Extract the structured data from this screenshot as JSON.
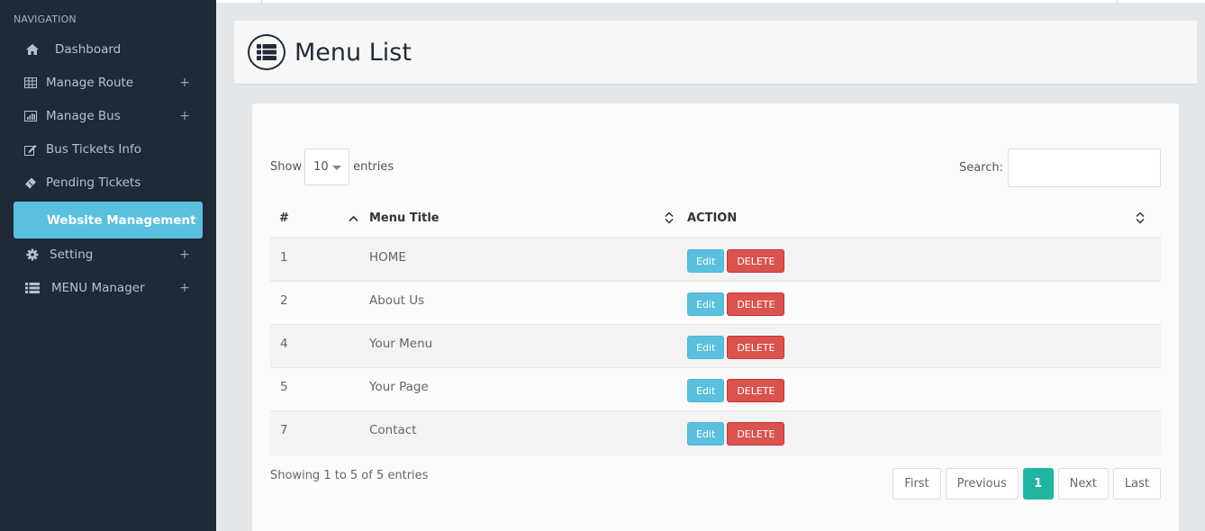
{
  "sidebar": {
    "heading": "NAVIGATION",
    "items": [
      {
        "label": "Dashboard",
        "icon": "home-icon",
        "expandable": false,
        "active": false
      },
      {
        "label": "Manage Route",
        "icon": "table-icon",
        "expandable": true,
        "active": false
      },
      {
        "label": "Manage Bus",
        "icon": "bar-chart-icon",
        "expandable": true,
        "active": false
      },
      {
        "label": "Bus Tickets Info",
        "icon": "edit-icon",
        "expandable": false,
        "active": false
      },
      {
        "label": "Pending Tickets",
        "icon": "ticket-icon",
        "expandable": false,
        "active": false
      },
      {
        "label": "Website Management",
        "icon": "",
        "expandable": false,
        "active": true
      },
      {
        "label": "Setting",
        "icon": "gear-icon",
        "expandable": true,
        "active": false
      },
      {
        "label": "MENU Manager",
        "icon": "list-icon",
        "expandable": true,
        "active": false
      }
    ],
    "expand_symbol": "+"
  },
  "header": {
    "title": "Menu List",
    "icon": "list-circle-icon"
  },
  "table_controls": {
    "show_label": "Show",
    "page_size": "10",
    "entries_label": "entries",
    "search_label": "Search:",
    "search_value": "",
    "search_placeholder": ""
  },
  "table": {
    "columns": [
      "#",
      "Menu Title",
      "ACTION"
    ],
    "rows": [
      {
        "id": "1",
        "title": "HOME"
      },
      {
        "id": "2",
        "title": "About Us"
      },
      {
        "id": "4",
        "title": "Your Menu"
      },
      {
        "id": "5",
        "title": "Your Page"
      },
      {
        "id": "7",
        "title": "Contact"
      }
    ],
    "edit_label": "Edit",
    "delete_label": "DELETE"
  },
  "footer": {
    "info": "Showing 1 to 5 of 5 entries",
    "pagination": {
      "first": "First",
      "previous": "Previous",
      "current": "1",
      "next": "Next",
      "last": "Last"
    }
  },
  "colors": {
    "sidebar_bg": "#1f2a38",
    "active_nav": "#5bc0de",
    "edit_button": "#5bc0de",
    "delete_button": "#d9534f",
    "active_page": "#1fb5a0"
  }
}
